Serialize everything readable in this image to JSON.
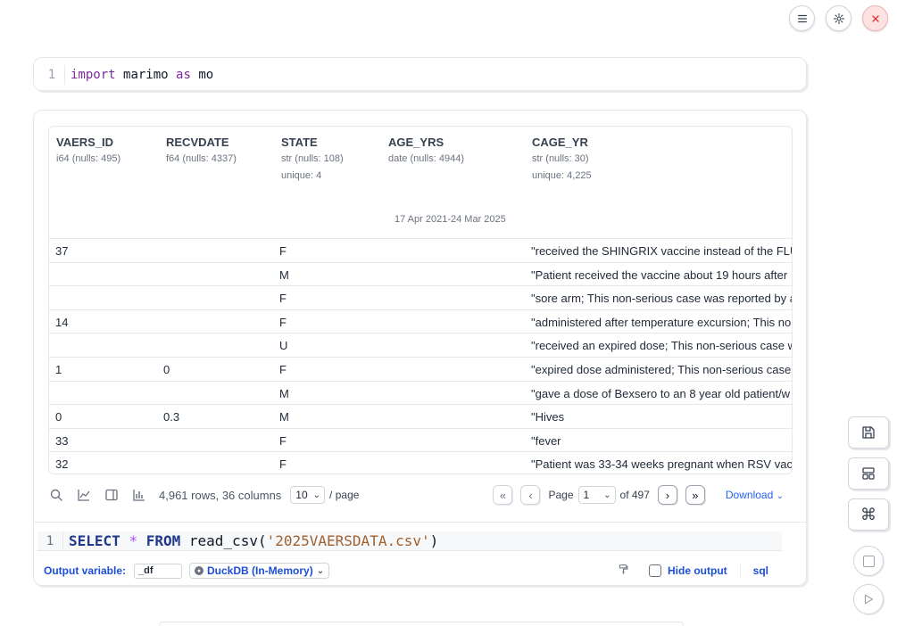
{
  "top_bar": {
    "menu_icon": "menu-icon",
    "settings_icon": "gear-icon",
    "close_icon": "close-icon"
  },
  "cell1": {
    "line_number": "1",
    "code": {
      "kw_import": "import",
      "module": "marimo",
      "kw_as": "as",
      "alias": "mo"
    }
  },
  "table": {
    "columns": [
      {
        "name": "VAERS_ID",
        "type": "i64 (nulls: 495)",
        "unique": ""
      },
      {
        "name": "RECVDATE",
        "type": "f64 (nulls: 4337)",
        "unique": ""
      },
      {
        "name": "STATE",
        "type": "str (nulls: 108)",
        "unique": "unique: 4"
      },
      {
        "name": "AGE_YRS",
        "type": "date (nulls: 4944)",
        "unique": ""
      },
      {
        "name": "CAGE_YR",
        "type": "str (nulls: 30)",
        "unique": "unique: 4,225"
      }
    ],
    "date_range": "17 Apr 2021-24 Mar 2025",
    "rows": [
      [
        "37",
        "",
        "F",
        "\"received the SHINGRIX vaccine instead of the FLU"
      ],
      [
        "",
        "",
        "M",
        "\"Patient received the vaccine about 19 hours after"
      ],
      [
        "",
        "",
        "F",
        "\"sore arm; This non-serious case was reported by a"
      ],
      [
        "14",
        "",
        "F",
        "\"administered after temperature excursion; This no"
      ],
      [
        "",
        "",
        "U",
        "\"received an expired dose; This non-serious case w"
      ],
      [
        "1",
        "0",
        "F",
        "\"expired dose administered; This non-serious case"
      ],
      [
        "",
        "",
        "M",
        "\"gave a dose of Bexsero to an 8 year old patient/w"
      ],
      [
        "0",
        "0.3",
        "M",
        "\"Hives"
      ],
      [
        "33",
        "",
        "F",
        "\"fever"
      ],
      [
        "32",
        "",
        "F",
        "\"Patient was 33-34 weeks pregnant when RSV vac"
      ]
    ]
  },
  "toolbar": {
    "summary": "4,961 rows, 36 columns",
    "page_size": "10",
    "per_page": "/ page",
    "page_label": "Page",
    "page_value": "1",
    "of_pages": "of 497",
    "download": "Download"
  },
  "sql": {
    "line_number": "1",
    "kw_select": "SELECT",
    "star": "*",
    "kw_from": "FROM",
    "fn": "read_csv(",
    "arg": "'2025VAERSDATA.csv'",
    "close": ")"
  },
  "config": {
    "output_variable_label": "Output variable:",
    "output_variable_value": "_df",
    "engine": "DuckDB (In-Memory)",
    "hide_output": "Hide output",
    "lang": "sql"
  },
  "side_buttons": [
    "save-icon",
    "layout-icon",
    "command-icon",
    "stop-icon",
    "run-icon"
  ]
}
